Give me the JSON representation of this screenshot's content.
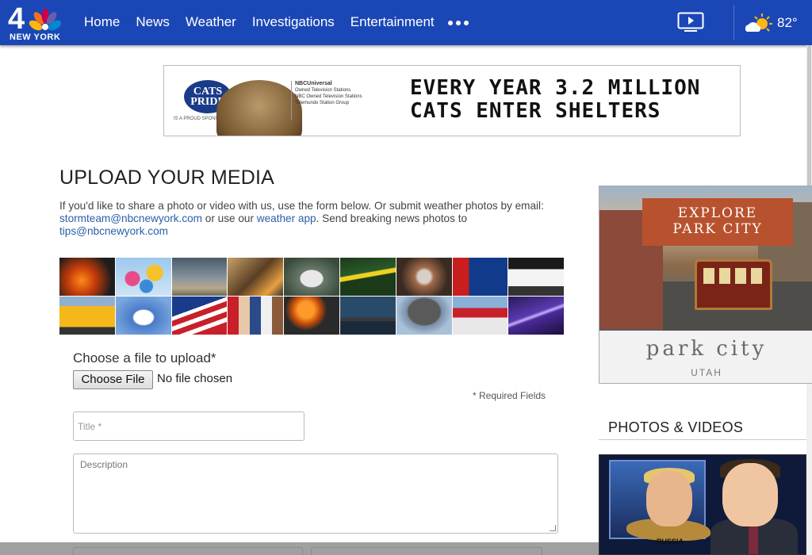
{
  "nav": {
    "logo_number": "4",
    "logo_text": "NEW YORK",
    "links": [
      "Home",
      "News",
      "Weather",
      "Investigations",
      "Entertainment"
    ],
    "more_icon": "more-dots-icon",
    "tv_icon": "play-video-icon",
    "weather_icon": "partly-cloudy-icon",
    "temperature": "82°",
    "brand_color": "#1b47b6"
  },
  "banner_ad": {
    "brand": "CATS PRIDE",
    "sponsor_text": "IS A PROUD SPONSOR",
    "partner_title": "NBCUniversal",
    "partner_line1": "Owned Television Stations",
    "partner_line2": "NBC Owned Television Stations",
    "partner_line3": "Telemundo Station Group",
    "headline_line1": "EVERY YEAR 3.2 MILLION",
    "headline_line2": "CATS ENTER SHELTERS"
  },
  "page": {
    "title": "UPLOAD YOUR MEDIA",
    "intro_text1": "If you'd like to share a photo or video with us, use the form below. Or submit weather photos by email: ",
    "intro_link_email": "stormteam@nbcnewyork.com",
    "intro_text2": " or use our ",
    "intro_link_app": "weather app",
    "intro_text3": ". Send breaking news photos to ",
    "intro_link_tips": "tips@nbcnewyork.com"
  },
  "photo_grid": [
    "fire-photo",
    "balloons-photo",
    "tornado-photo",
    "firefighters-photo",
    "flood-car-photo",
    "police-tape-photo",
    "hail-photo",
    "gas-prices-photo",
    "police-car-photo",
    "school-bus-photo",
    "helicopter-photo",
    "flag-photo",
    "crowd-photo",
    "truck-fire-photo",
    "bridge-photo",
    "smoke-plume-photo",
    "cyclone-coaster-photo",
    "lightning-photo"
  ],
  "form": {
    "file_label": "Choose a file to upload*",
    "file_button": "Choose File",
    "file_status": "No file chosen",
    "required_note": "*  Required Fields",
    "title_placeholder": "Title *",
    "description_placeholder": "Description"
  },
  "side_ad": {
    "headline_line1": "EXPLORE",
    "headline_line2": "PARK CITY",
    "brand": "park city",
    "state": "UTAH"
  },
  "sidebar": {
    "section_title": "PHOTOS & VIDEOS",
    "video_caption": "RUSSIA"
  }
}
